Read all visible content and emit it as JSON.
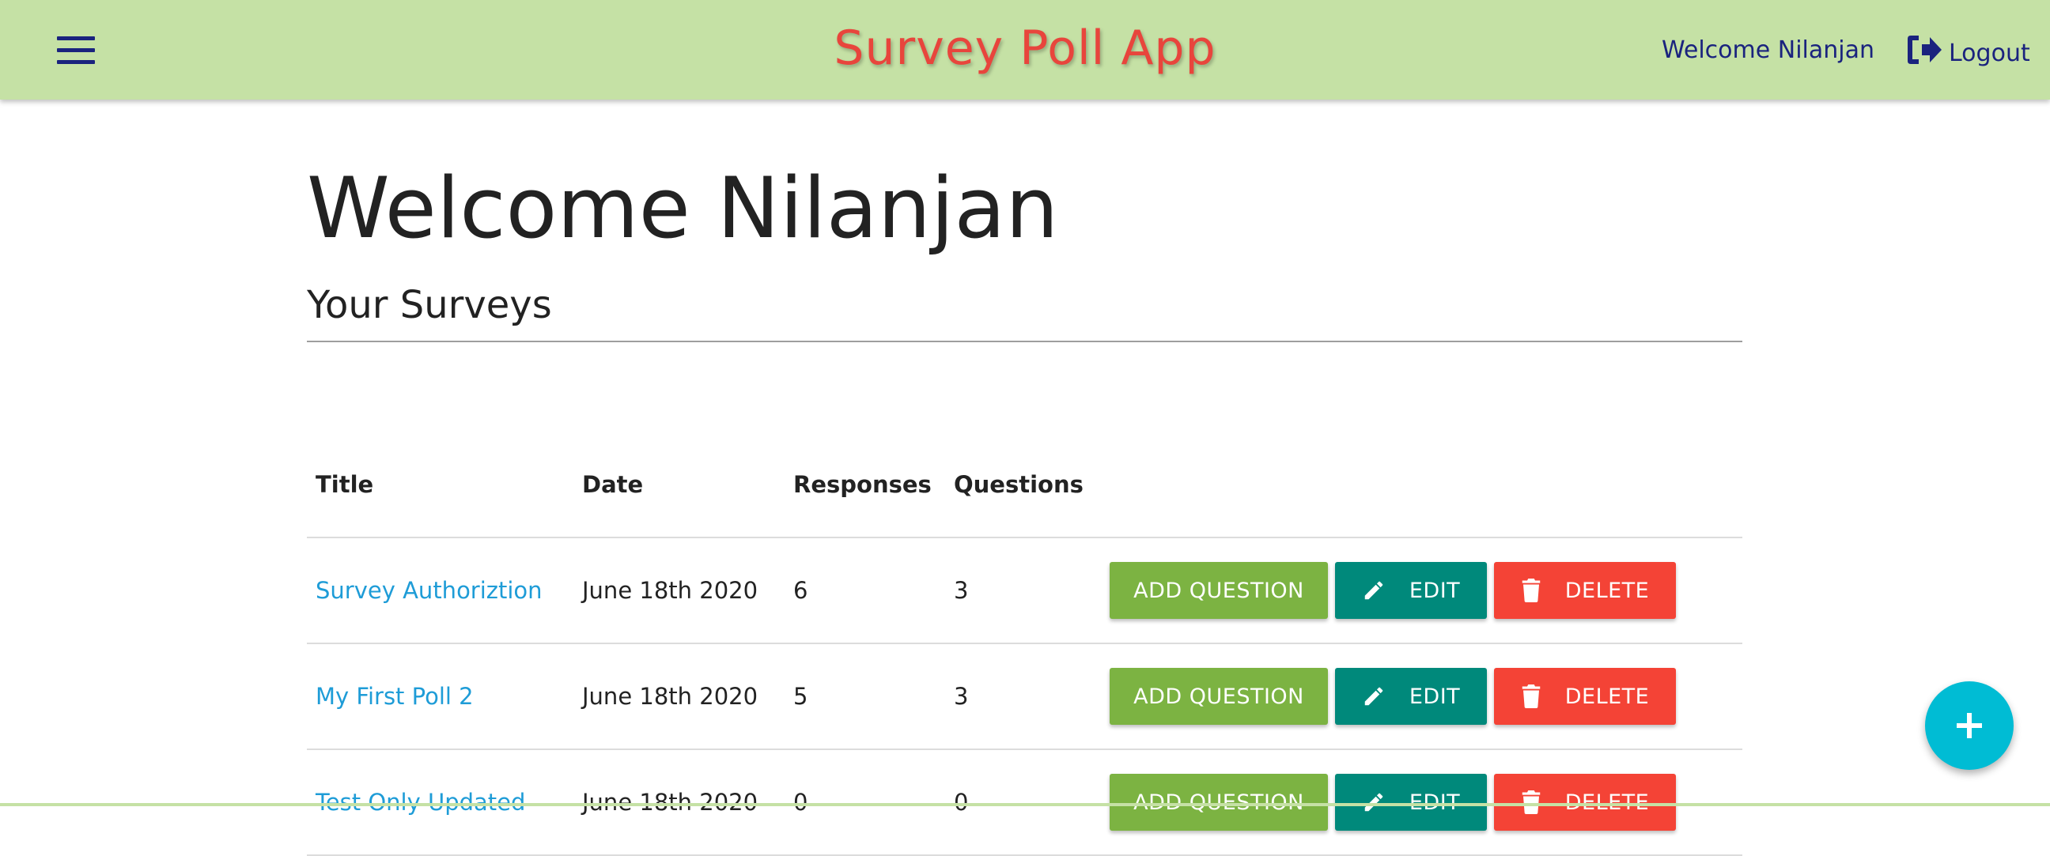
{
  "header": {
    "app_title": "Survey Poll App",
    "welcome": "Welcome Nilanjan",
    "logout_label": "Logout"
  },
  "main": {
    "title": "Welcome Nilanjan",
    "section_title": "Your Surveys"
  },
  "table": {
    "columns": [
      "Title",
      "Date",
      "Responses",
      "Questions"
    ],
    "rows": [
      {
        "title": "Survey Authoriztion",
        "date": "June 18th 2020",
        "responses": "6",
        "questions": "3"
      },
      {
        "title": "My First Poll 2",
        "date": "June 18th 2020",
        "responses": "5",
        "questions": "3"
      },
      {
        "title": "Test Only Updated",
        "date": "June 18th 2020",
        "responses": "0",
        "questions": "0"
      }
    ],
    "actions": {
      "add_question": "ADD QUESTION",
      "edit": "EDIT",
      "delete": "DELETE"
    }
  },
  "icons": {
    "menu": "hamburger-menu-icon",
    "logout": "sign-out-icon",
    "edit": "pencil-icon",
    "delete": "trash-icon",
    "fab": "plus-icon"
  },
  "colors": {
    "navbar": "#c5e1a5",
    "brand": "#e8453c",
    "nav_text": "#1a237e",
    "link": "#1e9cd7",
    "add_button": "#7cb342",
    "edit_button": "#00897b",
    "delete_button": "#f44336",
    "fab": "#00bcd4"
  }
}
